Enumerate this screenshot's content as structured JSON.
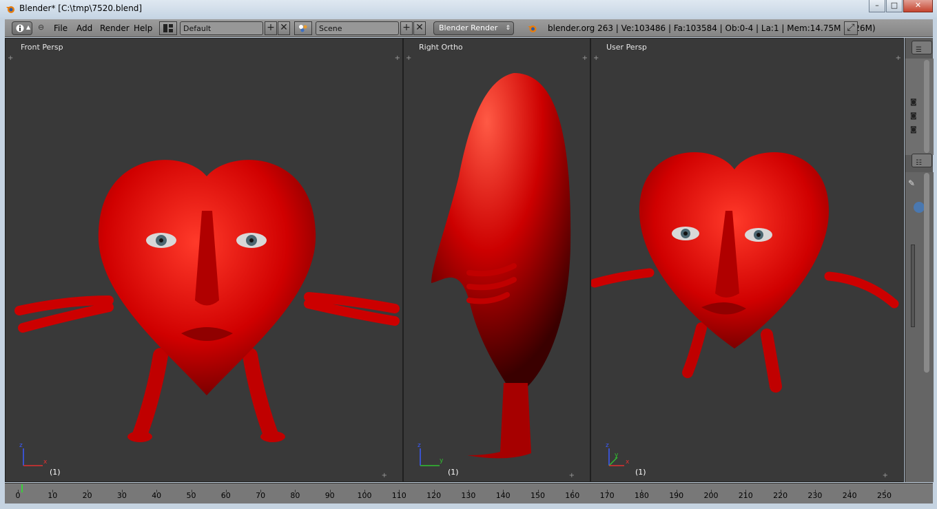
{
  "window": {
    "title": "Blender* [C:\\tmp\\7520.blend]",
    "buttons": {
      "minimize": "–",
      "maximize": "□",
      "close": "✕"
    }
  },
  "header": {
    "menus": [
      "File",
      "Add",
      "Render",
      "Help"
    ],
    "screen_layout": "Default",
    "scene": "Scene",
    "render_engine": "Blender Render",
    "stats": "blender.org 263 | Ve:103486 | Fa:103584 | Ob:0-4 | La:1 | Mem:14.75M (1.26M)"
  },
  "viewports": [
    {
      "label": "Front Persp",
      "frame": "(1)",
      "axes": [
        "z",
        "x"
      ]
    },
    {
      "label": "Right Ortho",
      "frame": "(1)",
      "axes": [
        "z",
        "y"
      ]
    },
    {
      "label": "User Persp",
      "frame": "(1)",
      "axes": [
        "z",
        "y",
        "x"
      ]
    }
  ],
  "timeline": {
    "ticks": [
      "0",
      "10",
      "20",
      "30",
      "40",
      "50",
      "60",
      "70",
      "80",
      "90",
      "100",
      "110",
      "120",
      "130",
      "140",
      "150",
      "160",
      "170",
      "180",
      "190",
      "200",
      "210",
      "220",
      "230",
      "240",
      "250"
    ],
    "current_frame": 1
  },
  "colors": {
    "model": "#d40000",
    "viewport_bg": "#393939",
    "header_bg": "#8a8a8a"
  }
}
